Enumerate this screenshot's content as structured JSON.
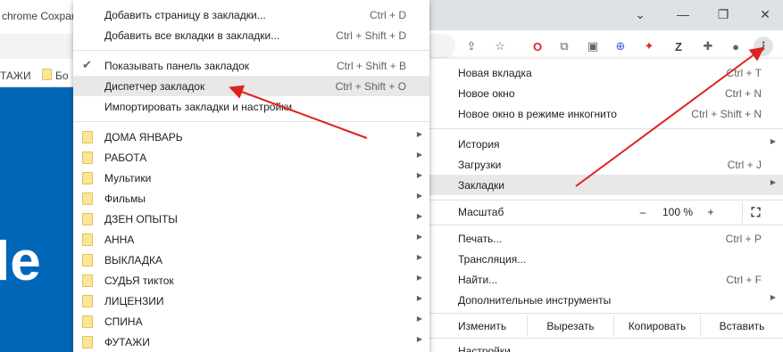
{
  "browser": {
    "tab_title": "chrome Сохран",
    "bookmark_bar": [
      "ТАЖИ",
      "Бо"
    ]
  },
  "page": {
    "fragment_text": "le"
  },
  "main_menu": {
    "items": [
      {
        "label": "Новая вкладка",
        "shortcut": "Ctrl + T"
      },
      {
        "label": "Новое окно",
        "shortcut": "Ctrl + N"
      },
      {
        "label": "Новое окно в режиме инкогнито",
        "shortcut": "Ctrl + Shift + N"
      },
      {
        "label": "История",
        "shortcut": ""
      },
      {
        "label": "Загрузки",
        "shortcut": "Ctrl + J"
      },
      {
        "label": "Закладки",
        "shortcut": ""
      },
      {
        "label": "Печать...",
        "shortcut": "Ctrl + P"
      },
      {
        "label": "Трансляция...",
        "shortcut": ""
      },
      {
        "label": "Найти...",
        "shortcut": "Ctrl + F"
      },
      {
        "label": "Дополнительные инструменты",
        "shortcut": ""
      },
      {
        "label": "Настройки",
        "shortcut": ""
      }
    ],
    "zoom": {
      "label": "Масштаб",
      "minus": "–",
      "value": "100 %",
      "plus": "+"
    },
    "edit": {
      "label": "Изменить",
      "cut": "Вырезать",
      "copy": "Копировать",
      "paste": "Вставить"
    }
  },
  "bookmarks_menu": {
    "actions": [
      {
        "label": "Добавить страницу в закладки...",
        "shortcut": "Ctrl + D"
      },
      {
        "label": "Добавить все вкладки в закладки...",
        "shortcut": "Ctrl + Shift + D"
      },
      {
        "label": "Показывать панель закладок",
        "shortcut": "Ctrl + Shift + B",
        "checked": true
      },
      {
        "label": "Диспетчер закладок",
        "shortcut": "Ctrl + Shift + O"
      },
      {
        "label": "Импортировать закладки и настройки",
        "shortcut": ""
      }
    ],
    "folders": [
      "ДОМА ЯНВАРЬ",
      "РАБОТА",
      "Мультики",
      "Фильмы",
      "ДЗЕН ОПЫТЫ",
      "АННА",
      "ВЫКЛАДКА",
      "СУДЬЯ тикток",
      "ЛИЦЕНЗИИ",
      "СПИНА",
      "ФУТАЖИ"
    ]
  },
  "colors": {
    "highlight": "#e8e8e8",
    "arrow": "#e02020",
    "page_blue": "#0067b8",
    "folder": "#fce695"
  }
}
